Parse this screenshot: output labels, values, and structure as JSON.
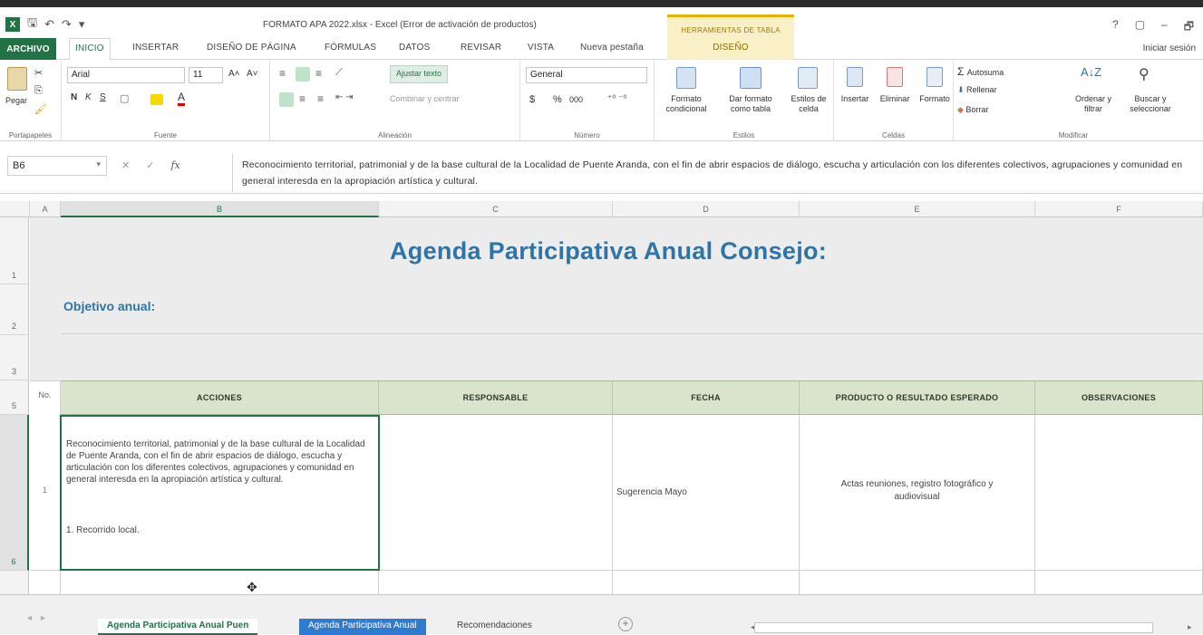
{
  "title_bar": {
    "document_title": "FORMATO APA 2022.xlsx - Excel (Error de activación de productos)",
    "context_group": "HERRAMIENTAS DE TABLA",
    "window_controls": [
      "?",
      "▢",
      "–",
      "🗗"
    ]
  },
  "ribbon_tabs": {
    "file": "ARCHIVO",
    "items": [
      "INICIO",
      "INSERTAR",
      "DISEÑO DE PÁGINA",
      "FÓRMULAS",
      "DATOS",
      "REVISAR",
      "VISTA",
      "Nueva pestaña"
    ],
    "active": "INICIO",
    "context_tab": "DISEÑO",
    "sign_in": "Iniciar sesión"
  },
  "ribbon": {
    "clipboard": {
      "paste": "Pegar",
      "label": "Portapapeles"
    },
    "font": {
      "name": "Arial",
      "size": "11",
      "bold": "N",
      "italic": "K",
      "underline": "S",
      "label": "Fuente"
    },
    "alignment": {
      "wrap": "Ajustar texto",
      "merge": "Combinar y centrar",
      "label": "Alineación"
    },
    "number": {
      "format": "General",
      "currency": "$",
      "percent": "%",
      "thousands": "000",
      "label": "Número"
    },
    "styles": {
      "conditional": "Formato condicional",
      "as_table": "Dar formato como tabla",
      "cell_styles": "Estilos de celda",
      "label": "Estilos"
    },
    "cells": {
      "insert": "Insertar",
      "delete": "Eliminar",
      "format": "Formato",
      "label": "Celdas"
    },
    "editing": {
      "autosum": "Autosuma",
      "fill": "Rellenar",
      "clear": "Borrar",
      "sort": "Ordenar y filtrar",
      "find": "Buscar y seleccionar",
      "label": "Modificar"
    }
  },
  "formula_bar": {
    "name_box": "B6",
    "fx": "fx",
    "content": "Reconocimiento territorial, patrimonial y de la base cultural  de la Localidad de Puente Aranda, con el fin de abrir espacios de diálogo, escucha y articulación con los diferentes colectivos, agrupaciones y comunidad en general interesda en la apropiación artística y cultural."
  },
  "columns": [
    "A",
    "B",
    "C",
    "D",
    "E",
    "F"
  ],
  "rows": [
    "1",
    "2",
    "3",
    "5",
    "6"
  ],
  "sheet": {
    "title": "Agenda Participativa Anual Consejo:",
    "objective_label": "Objetivo anual:",
    "table_headers": {
      "no": "No.",
      "acciones": "ACCIONES",
      "responsable": "RESPONSABLE",
      "fecha": "FECHA",
      "producto": "PRODUCTO O RESULTADO ESPERADO",
      "observaciones": "OBSERVACIONES"
    },
    "row1": {
      "no": "1",
      "acciones": "Reconocimiento territorial, patrimonial y de la base cultural de la Localidad de Puente Aranda, con el fin de abrir espacios de diálogo, escucha y articulación con los diferentes colectivos, agrupaciones y comunidad en general interesda en la apropiación artística y cultural.",
      "acciones_note": "1. Recorrido local.",
      "responsable": "",
      "fecha": "Sugerencia Mayo",
      "producto": "Actas reuniones, registro fotográfico y audiovisual",
      "observaciones": ""
    }
  },
  "sheet_tabs": [
    "Agenda Participativa Anual Puen",
    "Agenda Participativa Anual",
    "Recomendaciones"
  ],
  "active_sheet": "Agenda Participativa Anual Puen"
}
